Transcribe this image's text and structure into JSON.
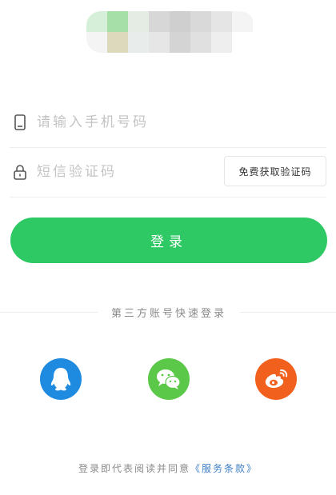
{
  "colors": {
    "primary": "#2ec964",
    "qq": "#1e8ae0",
    "wechat": "#5cc84a",
    "weibo": "#f2601d",
    "link": "#3f7fc7",
    "logo_cells": [
      "#d6efd8",
      "#a6e0a8",
      "#e4ece4",
      "#d7d7d7",
      "#cfcfcf",
      "#d9d9d9",
      "#e5e5e5",
      "#f4f4f4",
      "#f4f4f4",
      "#dcd9bd",
      "#e8eceb",
      "#e6e6e6",
      "#d4d4d4",
      "#e0e0e0",
      "#eeeeee",
      "#ffffff"
    ]
  },
  "form": {
    "phone": {
      "icon": "phone-icon",
      "value": "",
      "placeholder": "请输入手机号码"
    },
    "code": {
      "icon": "lock-icon",
      "value": "",
      "placeholder": "短信验证码",
      "get_code_label": "免费获取验证码"
    },
    "login_label": "登录"
  },
  "third_party": {
    "title": "第三方账号快速登录",
    "providers": [
      {
        "name": "QQ",
        "icon": "qq-icon"
      },
      {
        "name": "WeChat",
        "icon": "wechat-icon"
      },
      {
        "name": "Weibo",
        "icon": "weibo-icon"
      }
    ]
  },
  "footer": {
    "text": "登录即代表阅读并同意",
    "link": "《服务条款》"
  }
}
